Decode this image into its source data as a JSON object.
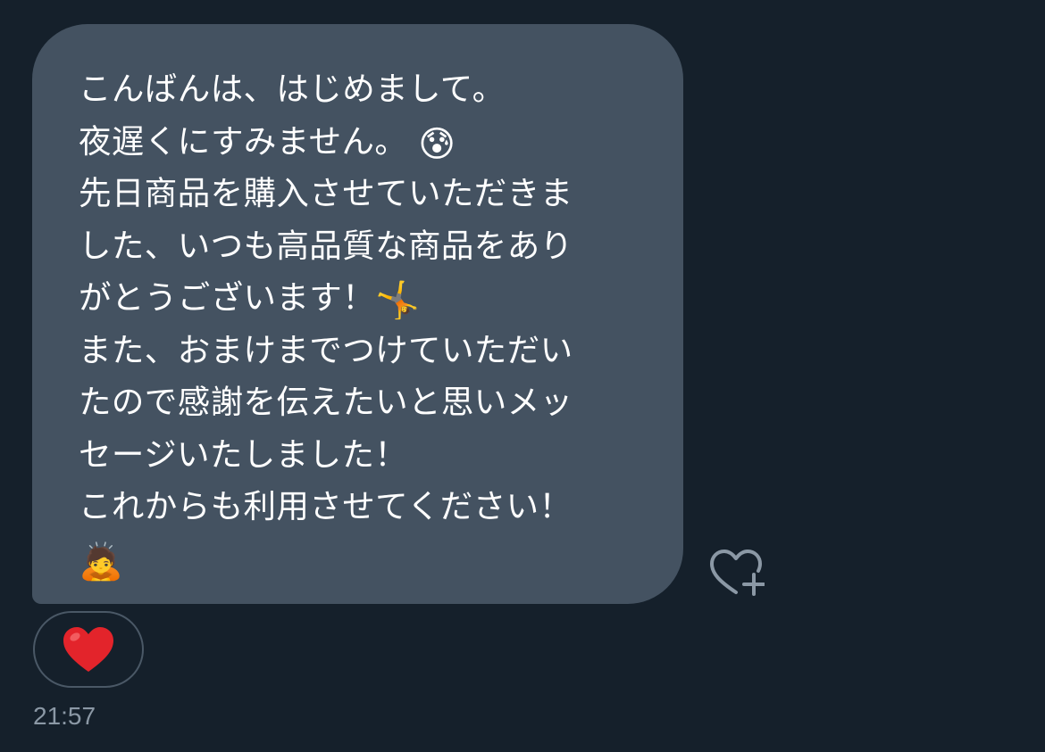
{
  "message": {
    "lines": [
      "こんばんは、はじめまして。",
      "夜遅くにすみません。",
      "先日商品を購入させていただきま",
      "した、いつも高品質な商品をあり",
      "がとうございます！",
      "また、おまけまでつけていただい",
      "たので感謝を伝えたいと思いメッ",
      "セージいたしました！",
      "これからも利用させてください！"
    ],
    "emojis": {
      "anxious_sweat": "😰",
      "cartwheel": "🤸",
      "bowing": "🙇"
    }
  },
  "reaction": {
    "emoji": "❤️",
    "icon": "red-heart"
  },
  "like_button": {
    "icon": "heart-plus-icon"
  },
  "timestamp": "21:57",
  "colors": {
    "background": "#15202b",
    "bubble": "#445261",
    "text": "#ffffff",
    "muted": "#8b98a5",
    "heart": "#e0245e"
  }
}
